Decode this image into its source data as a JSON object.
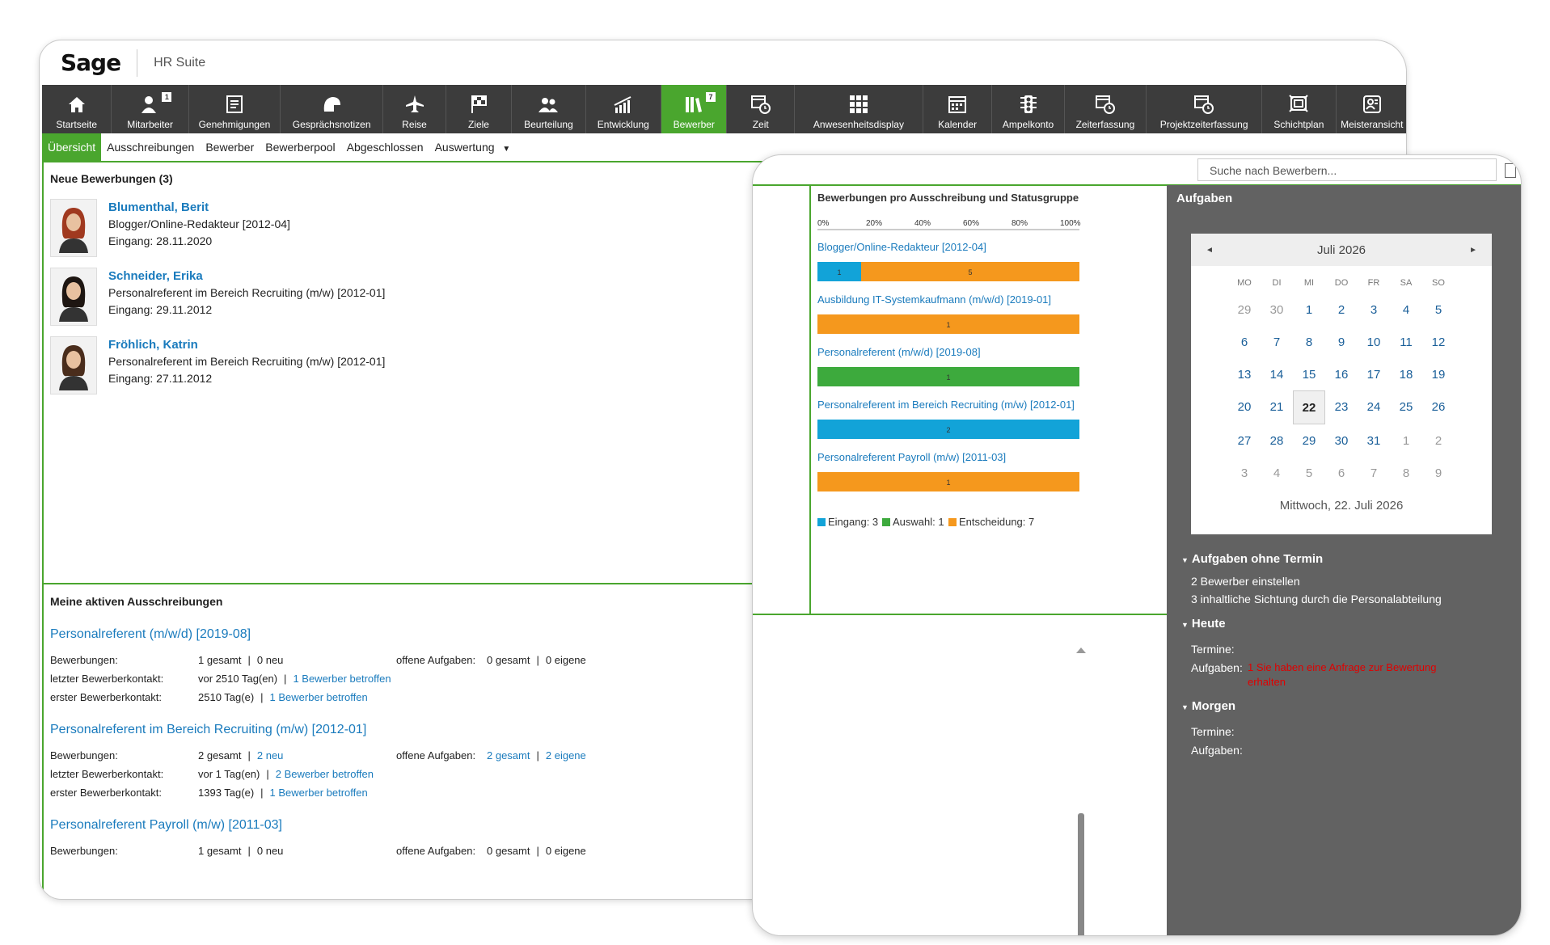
{
  "brand": {
    "logo": "Sage",
    "suite": "HR Suite"
  },
  "nav": {
    "items": [
      {
        "label": "Startseite",
        "icon": "home-icon",
        "width": 87
      },
      {
        "label": "Mitarbeiter",
        "icon": "employee-icon",
        "width": 96,
        "badge": "1"
      },
      {
        "label": "Genehmigungen",
        "icon": "approval-icon",
        "width": 114
      },
      {
        "label": "Gesprächsnotizen",
        "icon": "conversation-icon",
        "width": 128
      },
      {
        "label": "Reise",
        "icon": "airplane-icon",
        "width": 78
      },
      {
        "label": "Ziele",
        "icon": "flag-icon",
        "width": 82
      },
      {
        "label": "Beurteilung",
        "icon": "people-icon",
        "width": 92
      },
      {
        "label": "Entwicklung",
        "icon": "chart-up-icon",
        "width": 94
      },
      {
        "label": "Bewerber",
        "icon": "applicant-icon",
        "width": 82,
        "badge": "7",
        "active": true
      },
      {
        "label": "Zeit",
        "icon": "clock-calendar-icon",
        "width": 84
      },
      {
        "label": "Anwesenheitsdisplay",
        "icon": "grid-icon",
        "width": 160
      },
      {
        "label": "Kalender",
        "icon": "calendar-icon",
        "width": 86
      },
      {
        "label": "Ampelkonto",
        "icon": "traffic-light-icon",
        "width": 90
      },
      {
        "label": "Zeiterfassung",
        "icon": "time-entry-icon",
        "width": 102
      },
      {
        "label": "Projektzeiterfassung",
        "icon": "project-time-icon",
        "width": 144
      },
      {
        "label": "Schichtplan",
        "icon": "shift-plan-icon",
        "width": 92
      },
      {
        "label": "Meisteransicht",
        "icon": "master-view-icon",
        "width": 90
      }
    ]
  },
  "subnav": {
    "items": [
      "Übersicht",
      "Ausschreibungen",
      "Bewerber",
      "Bewerberpool",
      "Abgeschlossen",
      "Auswertung"
    ],
    "dropdown_arrow": "▼"
  },
  "new_applications": {
    "title": "Neue Bewerbungen (3)",
    "applicants": [
      {
        "name": "Blumenthal, Berit",
        "position": "Blogger/Online-Redakteur [2012-04]",
        "received": "Eingang: 28.11.2020",
        "hair": "#a0391f"
      },
      {
        "name": "Schneider, Erika",
        "position": "Personalreferent im Bereich Recruiting (m/w) [2012-01]",
        "received": "Eingang: 29.11.2012",
        "hair": "#1e1612"
      },
      {
        "name": "Fröhlich, Katrin",
        "position": "Personalreferent im Bereich Recruiting (m/w) [2012-01]",
        "received": "Eingang: 27.11.2012",
        "hair": "#4a2d1c"
      }
    ]
  },
  "active_postings": {
    "title": "Meine aktiven Ausschreibungen",
    "labels": {
      "applications": "Bewerbungen:",
      "last_contact": "letzter Bewerberkontakt:",
      "first_contact": "erster Bewerberkontakt:",
      "open_tasks": "offene Aufgaben:",
      "sep": "|"
    },
    "postings": [
      {
        "title": "Personalreferent (m/w/d) [2019-08]",
        "applications_total": "1 gesamt",
        "applications_new": "0 neu",
        "new_is_link": false,
        "tasks_total": "0 gesamt",
        "tasks_own": "0 eigene",
        "tasks_are_links": false,
        "last_contact": "vor 2510 Tag(en)",
        "last_link": "1 Bewerber betroffen",
        "first_contact": "2510 Tag(e)",
        "first_link": "1 Bewerber betroffen"
      },
      {
        "title": "Personalreferent im Bereich Recruiting (m/w) [2012-01]",
        "applications_total": "2 gesamt",
        "applications_new": "2 neu",
        "new_is_link": true,
        "tasks_total": "2 gesamt",
        "tasks_own": "2 eigene",
        "tasks_are_links": true,
        "last_contact": "vor 1 Tag(en)",
        "last_link": "2 Bewerber betroffen",
        "first_contact": "1393 Tag(e)",
        "first_link": "1 Bewerber betroffen"
      },
      {
        "title": "Personalreferent Payroll (m/w) [2011-03]",
        "applications_total": "1 gesamt",
        "applications_new": "0 neu",
        "new_is_link": false,
        "tasks_total": "0 gesamt",
        "tasks_own": "0 eigene",
        "tasks_are_links": false
      }
    ]
  },
  "search": {
    "placeholder": "Suche nach Bewerbern..."
  },
  "chart_data": {
    "type": "bar",
    "title": "Bewerbungen pro Ausschreibung und Statusgruppe",
    "stacked": "percent",
    "xticks": [
      "0%",
      "20%",
      "40%",
      "60%",
      "80%",
      "100%"
    ],
    "categories": [
      "Blogger/Online-Redakteur [2012-04]",
      "Ausbildung IT-Systemkaufmann (m/w/d) [2019-01]",
      "Personalreferent (m/w/d) [2019-08]",
      "Personalreferent im Bereich Recruiting (m/w) [2012-01]",
      "Personalreferent Payroll (m/w) [2011-03]"
    ],
    "series": [
      {
        "name": "Eingang",
        "color": "#12a3d8",
        "values": [
          1,
          0,
          0,
          2,
          0
        ]
      },
      {
        "name": "Auswahl",
        "color": "#3daa3d",
        "values": [
          0,
          0,
          1,
          0,
          0
        ]
      },
      {
        "name": "Entscheidung",
        "color": "#f5981d",
        "values": [
          5,
          1,
          0,
          0,
          1
        ]
      }
    ],
    "legend": [
      "Eingang: 3",
      "Auswahl: 1",
      "Entscheidung: 7"
    ],
    "legend_position": "bottom"
  },
  "sidebar": {
    "title": "Aufgaben",
    "calendar": {
      "month": "Juli 2026",
      "prev": "◄",
      "next": "►",
      "weekdays": [
        "MO",
        "DI",
        "MI",
        "DO",
        "FR",
        "SA",
        "SO"
      ],
      "days": [
        [
          "29",
          "30",
          "1",
          "2",
          "3",
          "4",
          "5"
        ],
        [
          "6",
          "7",
          "8",
          "9",
          "10",
          "11",
          "12"
        ],
        [
          "13",
          "14",
          "15",
          "16",
          "17",
          "18",
          "19"
        ],
        [
          "20",
          "21",
          "22",
          "23",
          "24",
          "25",
          "26"
        ],
        [
          "27",
          "28",
          "29",
          "30",
          "31",
          "1",
          "2"
        ],
        [
          "3",
          "4",
          "5",
          "6",
          "7",
          "8",
          "9"
        ]
      ],
      "today": "22",
      "today_label": "Mittwoch, 22. Juli 2026"
    },
    "no_date": {
      "title": "Aufgaben ohne Termin",
      "items": [
        "2 Bewerber einstellen",
        "3 inhaltliche Sichtung durch die Personalabteilung"
      ]
    },
    "today": {
      "title": "Heute",
      "appointments_label": "Termine:",
      "tasks_label": "Aufgaben:",
      "task_alert_line1": "1 Sie haben eine Anfrage zur Bewertung",
      "task_alert_line2": "erhalten"
    },
    "tomorrow": {
      "title": "Morgen",
      "appointments_label": "Termine:",
      "tasks_label": "Aufgaben:"
    }
  }
}
